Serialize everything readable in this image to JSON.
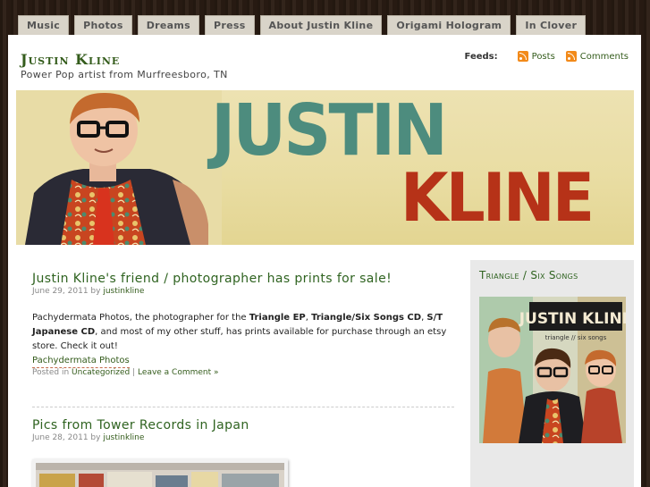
{
  "nav": {
    "tabs": [
      "Music",
      "Photos",
      "Dreams",
      "Press",
      "About Justin Kline",
      "Origami Hologram",
      "In Clover"
    ]
  },
  "header": {
    "site_title": "Justin Kline",
    "description": "Power Pop artist from Murfreesboro, TN",
    "feeds_label": "Feeds:",
    "feed_posts": "Posts",
    "feed_comments": "Comments"
  },
  "banner": {
    "line1": "JUSTIN",
    "line2": "KLINE",
    "colors": {
      "line1": "#4d8c7e",
      "line2": "#b63218",
      "background": "#ebdfa6"
    }
  },
  "posts": [
    {
      "title": "Justin Kline's friend / photographer has prints for sale!",
      "date": "June 29, 2011",
      "by": "by",
      "author": "justinkline",
      "body_pre": "Pachydermata Photos, the photographer for the ",
      "b1": "Triangle EP",
      "sep1": ", ",
      "b2": "Triangle/Six Songs CD",
      "sep2": ", ",
      "b3": "S/T Japanese CD",
      "body_post": ", and most of my other stuff, has prints available for purchase through an etsy store. Check it out!",
      "link": "Pachydermata Photos",
      "posted_in": "Posted in",
      "category": "Uncategorized",
      "foot_sep": "|",
      "comment_link": "Leave a Comment »"
    },
    {
      "title": "Pics from Tower Records in Japan",
      "date": "June 28, 2011",
      "by": "by",
      "author": "justinkline"
    }
  ],
  "sidebar": {
    "widget_title": "Triangle / Six Songs",
    "album_text": "JUSTIN KLINE",
    "album_sub": "triangle // six songs"
  }
}
